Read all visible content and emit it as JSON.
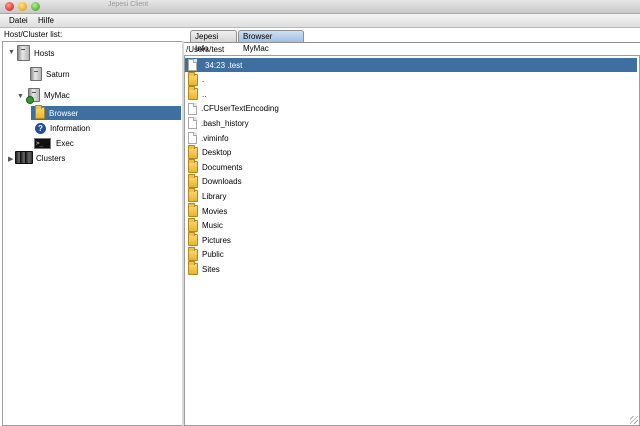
{
  "window": {
    "title": "Jepesi Client"
  },
  "menu": {
    "items": [
      "Datei",
      "Hilfe"
    ]
  },
  "left": {
    "label": "Host/Cluster list:",
    "tree": {
      "hosts": "Hosts",
      "saturn": "Saturn",
      "mymac": "MyMac",
      "browser": "Browser",
      "information": "Information",
      "exec": "Exec",
      "clusters": "Clusters",
      "exec_icon_text": ">_"
    }
  },
  "tabs": [
    {
      "label": "Jepesi Info",
      "active": false
    },
    {
      "label": "Browser MyMac",
      "active": true
    }
  ],
  "browser": {
    "path": "/Users/test",
    "selected_index": 0,
    "files": [
      {
        "name": "34:23 .test",
        "type": "file"
      },
      {
        "name": ".",
        "type": "folder"
      },
      {
        "name": "..",
        "type": "folder"
      },
      {
        "name": ".CFUserTextEncoding",
        "type": "file"
      },
      {
        "name": ".bash_history",
        "type": "file"
      },
      {
        "name": ".viminfo",
        "type": "file"
      },
      {
        "name": "Desktop",
        "type": "folder"
      },
      {
        "name": "Documents",
        "type": "folder"
      },
      {
        "name": "Downloads",
        "type": "folder"
      },
      {
        "name": "Library",
        "type": "folder"
      },
      {
        "name": "Movies",
        "type": "folder"
      },
      {
        "name": "Music",
        "type": "folder"
      },
      {
        "name": "Pictures",
        "type": "folder"
      },
      {
        "name": "Public",
        "type": "folder"
      },
      {
        "name": "Sites",
        "type": "folder"
      }
    ]
  },
  "colors": {
    "selection": "#3d6fa0",
    "folder": "#e9b52c"
  }
}
